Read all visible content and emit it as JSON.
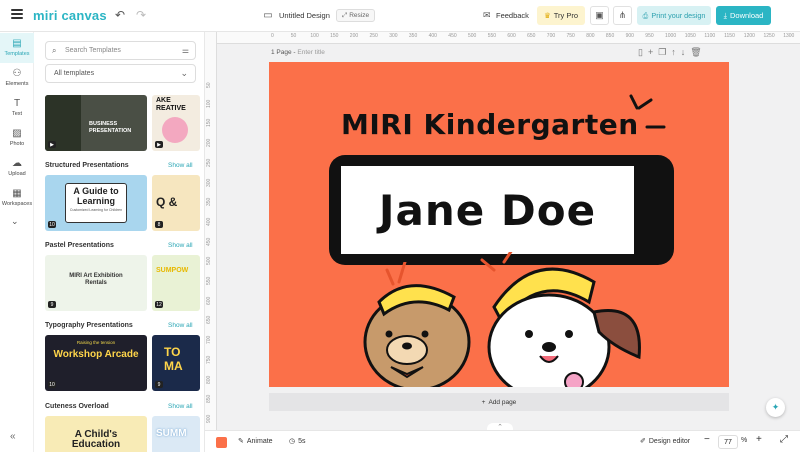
{
  "app": {
    "logo": "miri canvas"
  },
  "topbar": {
    "doc_title": "Untitled Design",
    "resize_label": "Resize",
    "feedback_label": "Feedback",
    "try_pro_label": "Try Pro",
    "print_label": "Print your design",
    "download_label": "Download"
  },
  "rail": {
    "items": [
      {
        "label": "Templates",
        "icon": "templates-icon"
      },
      {
        "label": "Elements",
        "icon": "elements-icon"
      },
      {
        "label": "Text",
        "icon": "text-icon"
      },
      {
        "label": "Photo",
        "icon": "photo-icon"
      },
      {
        "label": "Upload",
        "icon": "upload-icon"
      },
      {
        "label": "Workspaces",
        "icon": "workspaces-icon"
      }
    ]
  },
  "panel": {
    "search_placeholder": "Search Templates",
    "filter_value": "All templates",
    "sections": [
      {
        "title": "Structured Presentations",
        "show_all": "Show all"
      },
      {
        "title": "Pastel Presentations",
        "show_all": "Show all"
      },
      {
        "title": "Typography Presentations",
        "show_all": "Show all"
      },
      {
        "title": "Cuteness Overload",
        "show_all": "Show all"
      }
    ],
    "thumbs": {
      "t1": "BUSINESS PRESENTATION",
      "t2": "AKE REATIVE",
      "t3": "A Guide to Learning",
      "t3_sub": "Customized Learning for Children",
      "t3_num": "10",
      "t4": "Q &",
      "t4_num": "8",
      "t5": "MIRI Art Exhibition Rentals",
      "t5_num": "9",
      "t6": "SUMPOW",
      "t6_num": "12",
      "t7": "Workshop Arcade",
      "t7_top": "Raising the tension",
      "t7_num": "10",
      "t8": "TO MA",
      "t8_num": "9",
      "t9": "A Child's Education",
      "t10": "SUMM"
    }
  },
  "workspace": {
    "page_label": "1 Page",
    "page_title_placeholder": "Enter title",
    "ruler_top": [
      "0",
      "50",
      "100",
      "150",
      "200",
      "250",
      "300",
      "350",
      "400",
      "450",
      "500",
      "550",
      "600",
      "650",
      "700",
      "750",
      "800",
      "850",
      "900",
      "950",
      "1000",
      "1050",
      "1100",
      "1150",
      "1200",
      "1250",
      "1300"
    ],
    "ruler_left": [
      "50",
      "100",
      "150",
      "200",
      "250",
      "300",
      "350",
      "400",
      "450",
      "500",
      "550",
      "600",
      "650",
      "700",
      "750",
      "800",
      "850",
      "900"
    ],
    "add_page_label": "Add page"
  },
  "design": {
    "heading": "MIRI Kindergarten",
    "name": "Jane Doe",
    "bg_color": "#fb7049"
  },
  "bottombar": {
    "animate_label": "Animate",
    "duration_label": "5s",
    "editor_label": "Design editor",
    "zoom_value": "77",
    "zoom_unit": "%"
  },
  "colors": {
    "accent": "#2bb5c4",
    "canvas_bg": "#fb7049"
  }
}
